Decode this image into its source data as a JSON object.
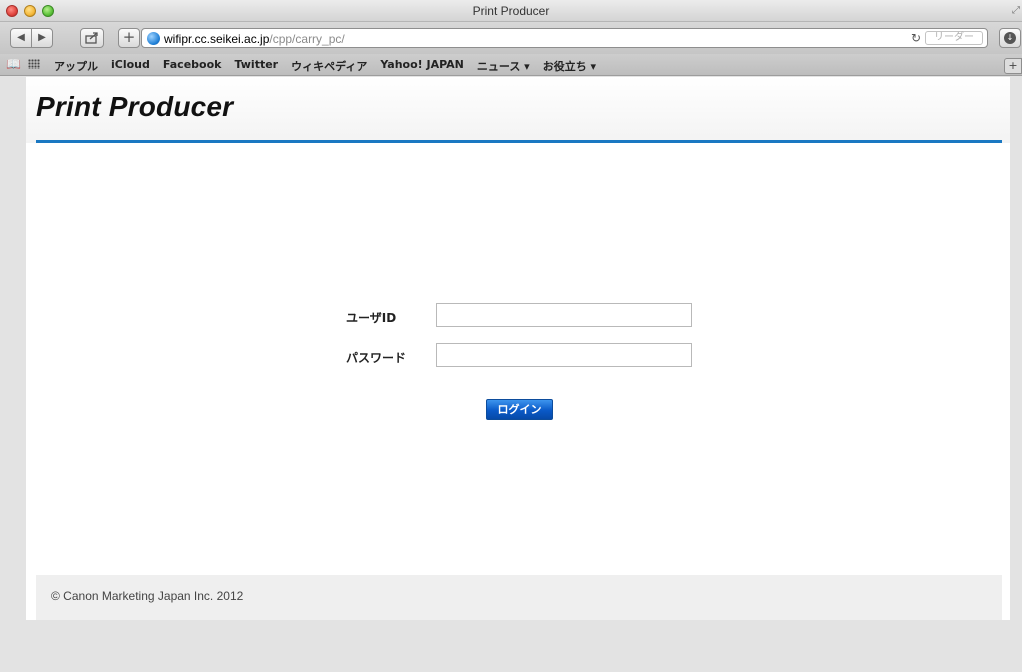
{
  "window": {
    "title": "Print Producer"
  },
  "toolbar": {
    "url_host": "wifipr.cc.seikei.ac.jp",
    "url_path": "/cpp/carry_pc/",
    "reader_label": "リーダー"
  },
  "bookmarks": [
    "アップル",
    "iCloud",
    "Facebook",
    "Twitter",
    "ウィキペディア",
    "Yahoo! JAPAN",
    "ニュース ▾",
    "お役立ち ▾"
  ],
  "page": {
    "logo": "Print Producer",
    "form": {
      "user_id_label": "ユーザID",
      "user_id_value": "",
      "password_label": "パスワード",
      "password_value": "",
      "login_label": "ログイン"
    },
    "footer": {
      "copyright": "© Canon Marketing Japan Inc. 2012"
    }
  },
  "colors": {
    "accent": "#1a78c2",
    "button": "#0a59c7"
  }
}
